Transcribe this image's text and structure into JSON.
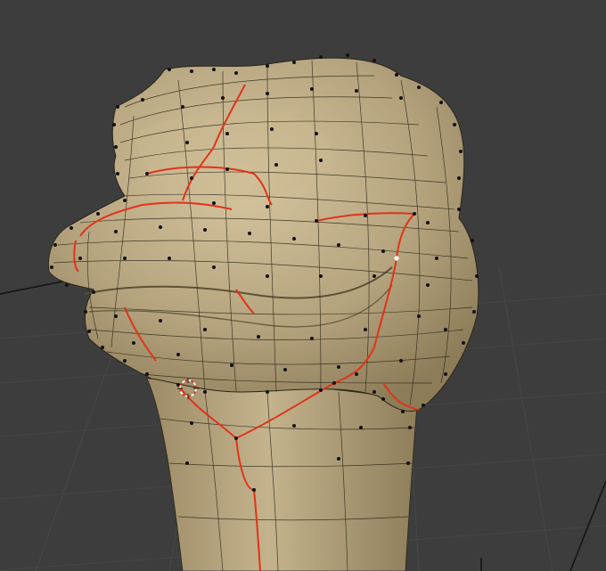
{
  "viewport": {
    "background_color": "#3d3d3d",
    "grid_color": "#4a4a4a",
    "mesh_fill_color": "#b5a37e",
    "mesh_shadow_color": "#8c7c58",
    "mesh_highlight_color": "#d6c59f",
    "wire_color": "#2a2618",
    "seam_color": "#e0341a",
    "vertex_color": "#111111",
    "eye_color": "#c9c9cc"
  },
  "icons": {
    "cursor": "3d-cursor-icon",
    "mesh": "mesh-object"
  }
}
